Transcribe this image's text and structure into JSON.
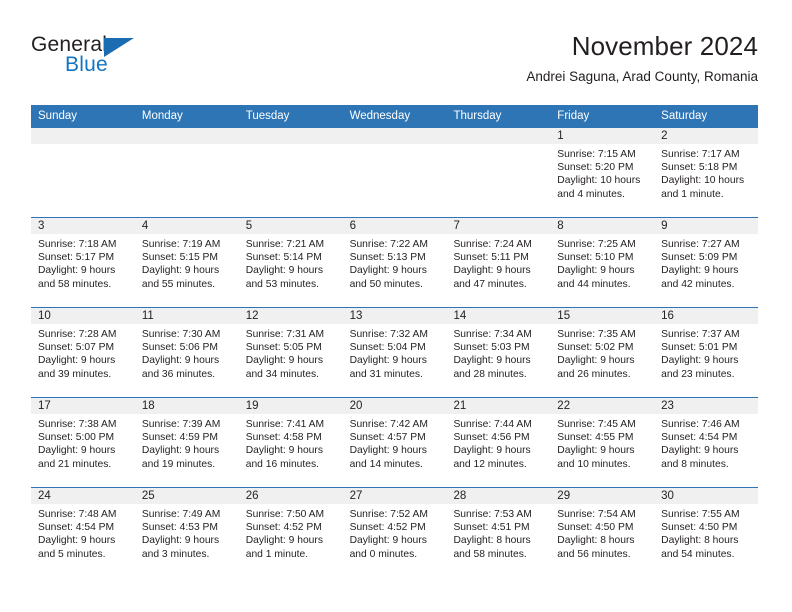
{
  "brand": {
    "name_part1": "General",
    "name_part2": "Blue",
    "flag_icon": "triangle-flag-icon",
    "accent_color": "#1b6cb0"
  },
  "header": {
    "month_title": "November 2024",
    "location": "Andrei Saguna, Arad County, Romania"
  },
  "theme": {
    "header_blue": "#2e75b6",
    "day_band_gray": "#f0f0f0",
    "text_color": "#231f20"
  },
  "calendar": {
    "weekdays": [
      "Sunday",
      "Monday",
      "Tuesday",
      "Wednesday",
      "Thursday",
      "Friday",
      "Saturday"
    ],
    "weeks": [
      [
        {
          "day": "",
          "empty": true,
          "sunrise": "",
          "sunset": "",
          "daylight_line1": "",
          "daylight_line2": ""
        },
        {
          "day": "",
          "empty": true,
          "sunrise": "",
          "sunset": "",
          "daylight_line1": "",
          "daylight_line2": ""
        },
        {
          "day": "",
          "empty": true,
          "sunrise": "",
          "sunset": "",
          "daylight_line1": "",
          "daylight_line2": ""
        },
        {
          "day": "",
          "empty": true,
          "sunrise": "",
          "sunset": "",
          "daylight_line1": "",
          "daylight_line2": ""
        },
        {
          "day": "",
          "empty": true,
          "sunrise": "",
          "sunset": "",
          "daylight_line1": "",
          "daylight_line2": ""
        },
        {
          "day": "1",
          "sunrise": "Sunrise: 7:15 AM",
          "sunset": "Sunset: 5:20 PM",
          "daylight_line1": "Daylight: 10 hours",
          "daylight_line2": "and 4 minutes."
        },
        {
          "day": "2",
          "sunrise": "Sunrise: 7:17 AM",
          "sunset": "Sunset: 5:18 PM",
          "daylight_line1": "Daylight: 10 hours",
          "daylight_line2": "and 1 minute."
        }
      ],
      [
        {
          "day": "3",
          "sunrise": "Sunrise: 7:18 AM",
          "sunset": "Sunset: 5:17 PM",
          "daylight_line1": "Daylight: 9 hours",
          "daylight_line2": "and 58 minutes."
        },
        {
          "day": "4",
          "sunrise": "Sunrise: 7:19 AM",
          "sunset": "Sunset: 5:15 PM",
          "daylight_line1": "Daylight: 9 hours",
          "daylight_line2": "and 55 minutes."
        },
        {
          "day": "5",
          "sunrise": "Sunrise: 7:21 AM",
          "sunset": "Sunset: 5:14 PM",
          "daylight_line1": "Daylight: 9 hours",
          "daylight_line2": "and 53 minutes."
        },
        {
          "day": "6",
          "sunrise": "Sunrise: 7:22 AM",
          "sunset": "Sunset: 5:13 PM",
          "daylight_line1": "Daylight: 9 hours",
          "daylight_line2": "and 50 minutes."
        },
        {
          "day": "7",
          "sunrise": "Sunrise: 7:24 AM",
          "sunset": "Sunset: 5:11 PM",
          "daylight_line1": "Daylight: 9 hours",
          "daylight_line2": "and 47 minutes."
        },
        {
          "day": "8",
          "sunrise": "Sunrise: 7:25 AM",
          "sunset": "Sunset: 5:10 PM",
          "daylight_line1": "Daylight: 9 hours",
          "daylight_line2": "and 44 minutes."
        },
        {
          "day": "9",
          "sunrise": "Sunrise: 7:27 AM",
          "sunset": "Sunset: 5:09 PM",
          "daylight_line1": "Daylight: 9 hours",
          "daylight_line2": "and 42 minutes."
        }
      ],
      [
        {
          "day": "10",
          "sunrise": "Sunrise: 7:28 AM",
          "sunset": "Sunset: 5:07 PM",
          "daylight_line1": "Daylight: 9 hours",
          "daylight_line2": "and 39 minutes."
        },
        {
          "day": "11",
          "sunrise": "Sunrise: 7:30 AM",
          "sunset": "Sunset: 5:06 PM",
          "daylight_line1": "Daylight: 9 hours",
          "daylight_line2": "and 36 minutes."
        },
        {
          "day": "12",
          "sunrise": "Sunrise: 7:31 AM",
          "sunset": "Sunset: 5:05 PM",
          "daylight_line1": "Daylight: 9 hours",
          "daylight_line2": "and 34 minutes."
        },
        {
          "day": "13",
          "sunrise": "Sunrise: 7:32 AM",
          "sunset": "Sunset: 5:04 PM",
          "daylight_line1": "Daylight: 9 hours",
          "daylight_line2": "and 31 minutes."
        },
        {
          "day": "14",
          "sunrise": "Sunrise: 7:34 AM",
          "sunset": "Sunset: 5:03 PM",
          "daylight_line1": "Daylight: 9 hours",
          "daylight_line2": "and 28 minutes."
        },
        {
          "day": "15",
          "sunrise": "Sunrise: 7:35 AM",
          "sunset": "Sunset: 5:02 PM",
          "daylight_line1": "Daylight: 9 hours",
          "daylight_line2": "and 26 minutes."
        },
        {
          "day": "16",
          "sunrise": "Sunrise: 7:37 AM",
          "sunset": "Sunset: 5:01 PM",
          "daylight_line1": "Daylight: 9 hours",
          "daylight_line2": "and 23 minutes."
        }
      ],
      [
        {
          "day": "17",
          "sunrise": "Sunrise: 7:38 AM",
          "sunset": "Sunset: 5:00 PM",
          "daylight_line1": "Daylight: 9 hours",
          "daylight_line2": "and 21 minutes."
        },
        {
          "day": "18",
          "sunrise": "Sunrise: 7:39 AM",
          "sunset": "Sunset: 4:59 PM",
          "daylight_line1": "Daylight: 9 hours",
          "daylight_line2": "and 19 minutes."
        },
        {
          "day": "19",
          "sunrise": "Sunrise: 7:41 AM",
          "sunset": "Sunset: 4:58 PM",
          "daylight_line1": "Daylight: 9 hours",
          "daylight_line2": "and 16 minutes."
        },
        {
          "day": "20",
          "sunrise": "Sunrise: 7:42 AM",
          "sunset": "Sunset: 4:57 PM",
          "daylight_line1": "Daylight: 9 hours",
          "daylight_line2": "and 14 minutes."
        },
        {
          "day": "21",
          "sunrise": "Sunrise: 7:44 AM",
          "sunset": "Sunset: 4:56 PM",
          "daylight_line1": "Daylight: 9 hours",
          "daylight_line2": "and 12 minutes."
        },
        {
          "day": "22",
          "sunrise": "Sunrise: 7:45 AM",
          "sunset": "Sunset: 4:55 PM",
          "daylight_line1": "Daylight: 9 hours",
          "daylight_line2": "and 10 minutes."
        },
        {
          "day": "23",
          "sunrise": "Sunrise: 7:46 AM",
          "sunset": "Sunset: 4:54 PM",
          "daylight_line1": "Daylight: 9 hours",
          "daylight_line2": "and 8 minutes."
        }
      ],
      [
        {
          "day": "24",
          "sunrise": "Sunrise: 7:48 AM",
          "sunset": "Sunset: 4:54 PM",
          "daylight_line1": "Daylight: 9 hours",
          "daylight_line2": "and 5 minutes."
        },
        {
          "day": "25",
          "sunrise": "Sunrise: 7:49 AM",
          "sunset": "Sunset: 4:53 PM",
          "daylight_line1": "Daylight: 9 hours",
          "daylight_line2": "and 3 minutes."
        },
        {
          "day": "26",
          "sunrise": "Sunrise: 7:50 AM",
          "sunset": "Sunset: 4:52 PM",
          "daylight_line1": "Daylight: 9 hours",
          "daylight_line2": "and 1 minute."
        },
        {
          "day": "27",
          "sunrise": "Sunrise: 7:52 AM",
          "sunset": "Sunset: 4:52 PM",
          "daylight_line1": "Daylight: 9 hours",
          "daylight_line2": "and 0 minutes."
        },
        {
          "day": "28",
          "sunrise": "Sunrise: 7:53 AM",
          "sunset": "Sunset: 4:51 PM",
          "daylight_line1": "Daylight: 8 hours",
          "daylight_line2": "and 58 minutes."
        },
        {
          "day": "29",
          "sunrise": "Sunrise: 7:54 AM",
          "sunset": "Sunset: 4:50 PM",
          "daylight_line1": "Daylight: 8 hours",
          "daylight_line2": "and 56 minutes."
        },
        {
          "day": "30",
          "sunrise": "Sunrise: 7:55 AM",
          "sunset": "Sunset: 4:50 PM",
          "daylight_line1": "Daylight: 8 hours",
          "daylight_line2": "and 54 minutes."
        }
      ]
    ]
  }
}
